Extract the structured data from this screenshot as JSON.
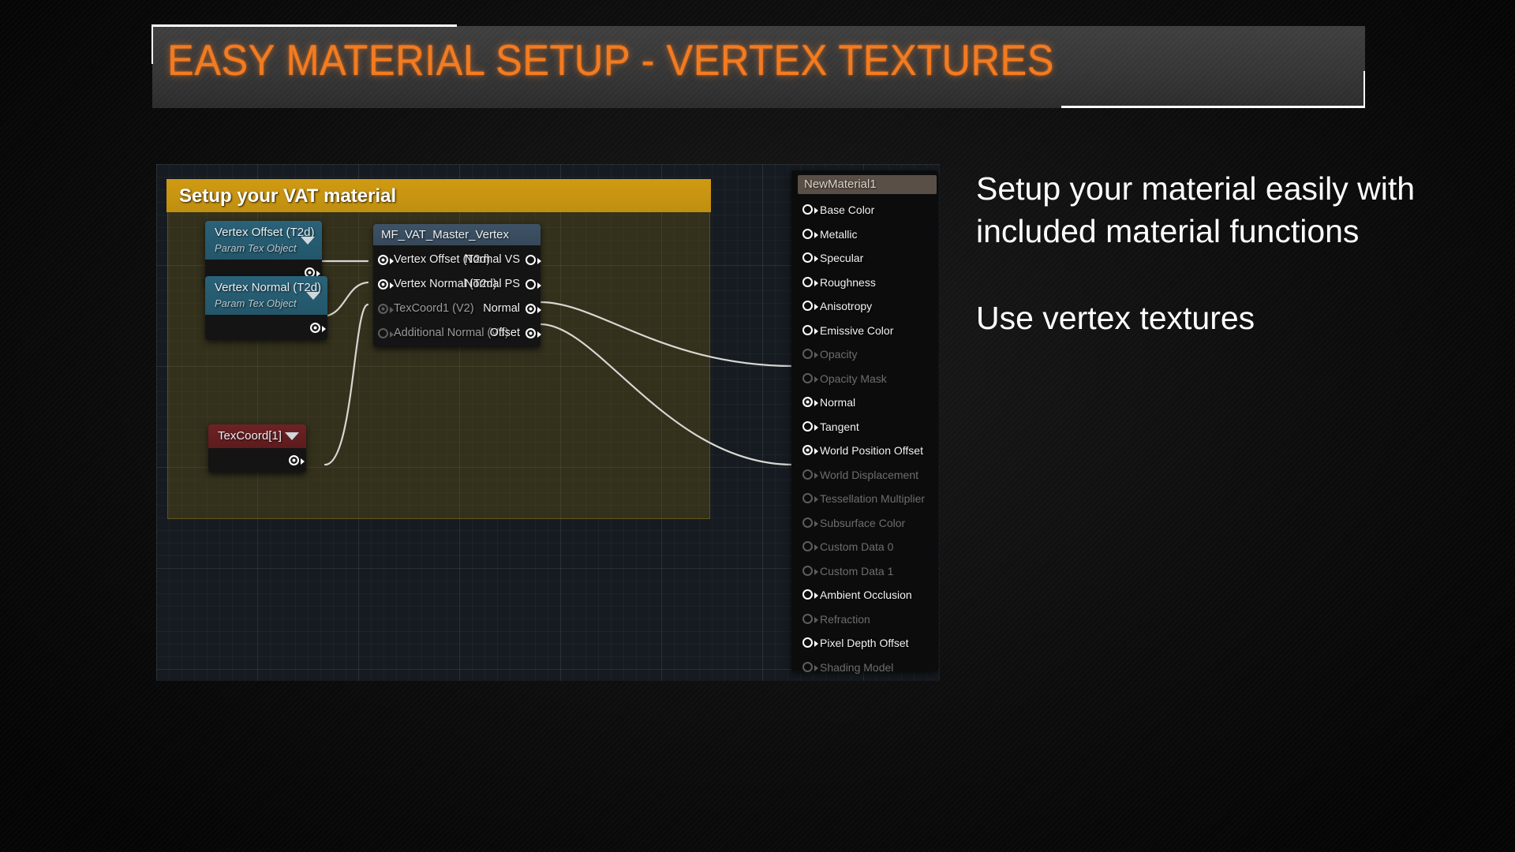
{
  "slide": {
    "title": "EASY MATERIAL SETUP - VERTEX TEXTURES",
    "title_color": "#f47b20",
    "background_color": "#0b0b0b"
  },
  "graph": {
    "comment": {
      "title": "Setup your VAT material",
      "header_color": "#c9960f",
      "body_color": "#6d5a10"
    },
    "nodes": {
      "vertex_offset_param": {
        "title": "Vertex Offset (T2d)",
        "subtitle": "Param Tex Object",
        "header_color": "#2a6279"
      },
      "vertex_normal_param": {
        "title": "Vertex Normal (T2d)",
        "subtitle": "Param Tex Object",
        "header_color": "#2a6279"
      },
      "texcoord": {
        "title": "TexCoord[1]",
        "header_color": "#6e2224"
      },
      "material_function": {
        "title": "MF_VAT_Master_Vertex",
        "header_color": "#3d5366",
        "inputs": [
          {
            "label": "Vertex Offset (T2d)",
            "connected": true,
            "filled": true
          },
          {
            "label": "Vertex Normal (T2d)",
            "connected": true,
            "filled": true
          },
          {
            "label": "TexCoord1 (V2)",
            "connected": true,
            "filled": true,
            "dim": true
          },
          {
            "label": "Additional Normal (V3)",
            "connected": false,
            "filled": false,
            "dim": true
          }
        ],
        "outputs": [
          {
            "label": "Normal VS",
            "filled": false
          },
          {
            "label": "Normal PS",
            "filled": false
          },
          {
            "label": "Normal",
            "filled": true
          },
          {
            "label": "Offset",
            "filled": true
          }
        ]
      }
    },
    "material_output": {
      "name": "NewMaterial1",
      "header_color": "#5a4f46",
      "pins": [
        {
          "label": "Base Color",
          "enabled": true,
          "connected": false
        },
        {
          "label": "Metallic",
          "enabled": true,
          "connected": false
        },
        {
          "label": "Specular",
          "enabled": true,
          "connected": false
        },
        {
          "label": "Roughness",
          "enabled": true,
          "connected": false
        },
        {
          "label": "Anisotropy",
          "enabled": true,
          "connected": false
        },
        {
          "label": "Emissive Color",
          "enabled": true,
          "connected": false
        },
        {
          "label": "Opacity",
          "enabled": false,
          "connected": false
        },
        {
          "label": "Opacity Mask",
          "enabled": false,
          "connected": false
        },
        {
          "label": "Normal",
          "enabled": true,
          "connected": true
        },
        {
          "label": "Tangent",
          "enabled": true,
          "connected": false
        },
        {
          "label": "World Position Offset",
          "enabled": true,
          "connected": true
        },
        {
          "label": "World Displacement",
          "enabled": false,
          "connected": false
        },
        {
          "label": "Tessellation Multiplier",
          "enabled": false,
          "connected": false
        },
        {
          "label": "Subsurface Color",
          "enabled": false,
          "connected": false
        },
        {
          "label": "Custom Data 0",
          "enabled": false,
          "connected": false
        },
        {
          "label": "Custom Data 1",
          "enabled": false,
          "connected": false
        },
        {
          "label": "Ambient Occlusion",
          "enabled": true,
          "connected": false
        },
        {
          "label": "Refraction",
          "enabled": false,
          "connected": false
        },
        {
          "label": "Pixel Depth Offset",
          "enabled": true,
          "connected": false
        },
        {
          "label": "Shading Model",
          "enabled": false,
          "connected": false
        }
      ]
    }
  },
  "copy": {
    "paragraph_1": "Setup your material easily with included material functions",
    "paragraph_2": "Use vertex textures"
  }
}
